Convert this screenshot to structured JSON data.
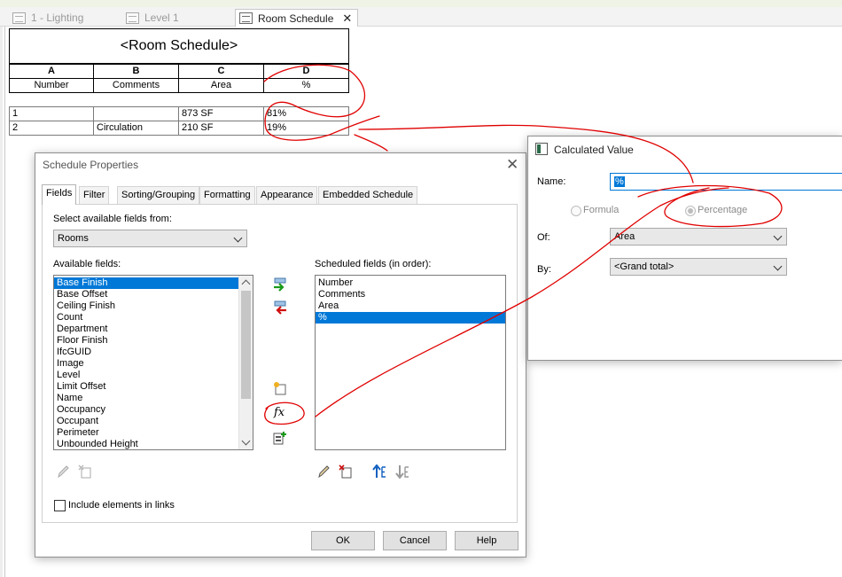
{
  "tabs": [
    {
      "label": "1 - Lighting",
      "active": false
    },
    {
      "label": "Level 1",
      "active": false
    },
    {
      "label": "Room Schedule",
      "active": true
    }
  ],
  "schedule": {
    "title": "<Room Schedule>",
    "column_letters": [
      "A",
      "B",
      "C",
      "D"
    ],
    "headers": [
      "Number",
      "Comments",
      "Area",
      "%"
    ],
    "rows": [
      [
        "1",
        "",
        "873 SF",
        "81%"
      ],
      [
        "2",
        "Circulation",
        "210 SF",
        "19%"
      ]
    ]
  },
  "schedule_properties": {
    "title": "Schedule Properties",
    "tabs": [
      "Fields",
      "Filter",
      "Sorting/Grouping",
      "Formatting",
      "Appearance",
      "Embedded Schedule"
    ],
    "active_tab": "Fields",
    "select_label": "Select available fields from:",
    "select_value": "Rooms",
    "available_label": "Available fields:",
    "available_fields": [
      "Base Finish",
      "Base Offset",
      "Ceiling Finish",
      "Count",
      "Department",
      "Floor Finish",
      "IfcGUID",
      "Image",
      "Level",
      "Limit Offset",
      "Name",
      "Occupancy",
      "Occupant",
      "Perimeter",
      "Unbounded Height"
    ],
    "scheduled_label": "Scheduled fields (in order):",
    "scheduled_fields": [
      "Number",
      "Comments",
      "Area",
      "%"
    ],
    "include_links_label": "Include elements in links",
    "buttons": {
      "ok": "OK",
      "cancel": "Cancel",
      "help": "Help"
    },
    "formula_icon_text": "fx"
  },
  "calculated_value": {
    "title": "Calculated Value",
    "name_label": "Name:",
    "name_value": "%",
    "formula_label": "Formula",
    "percentage_label": "Percentage",
    "of_label": "Of:",
    "of_value": "Area",
    "by_label": "By:",
    "by_value": "<Grand total>"
  },
  "colors": {
    "selection": "#0078d7",
    "annotation": "#e00000"
  }
}
